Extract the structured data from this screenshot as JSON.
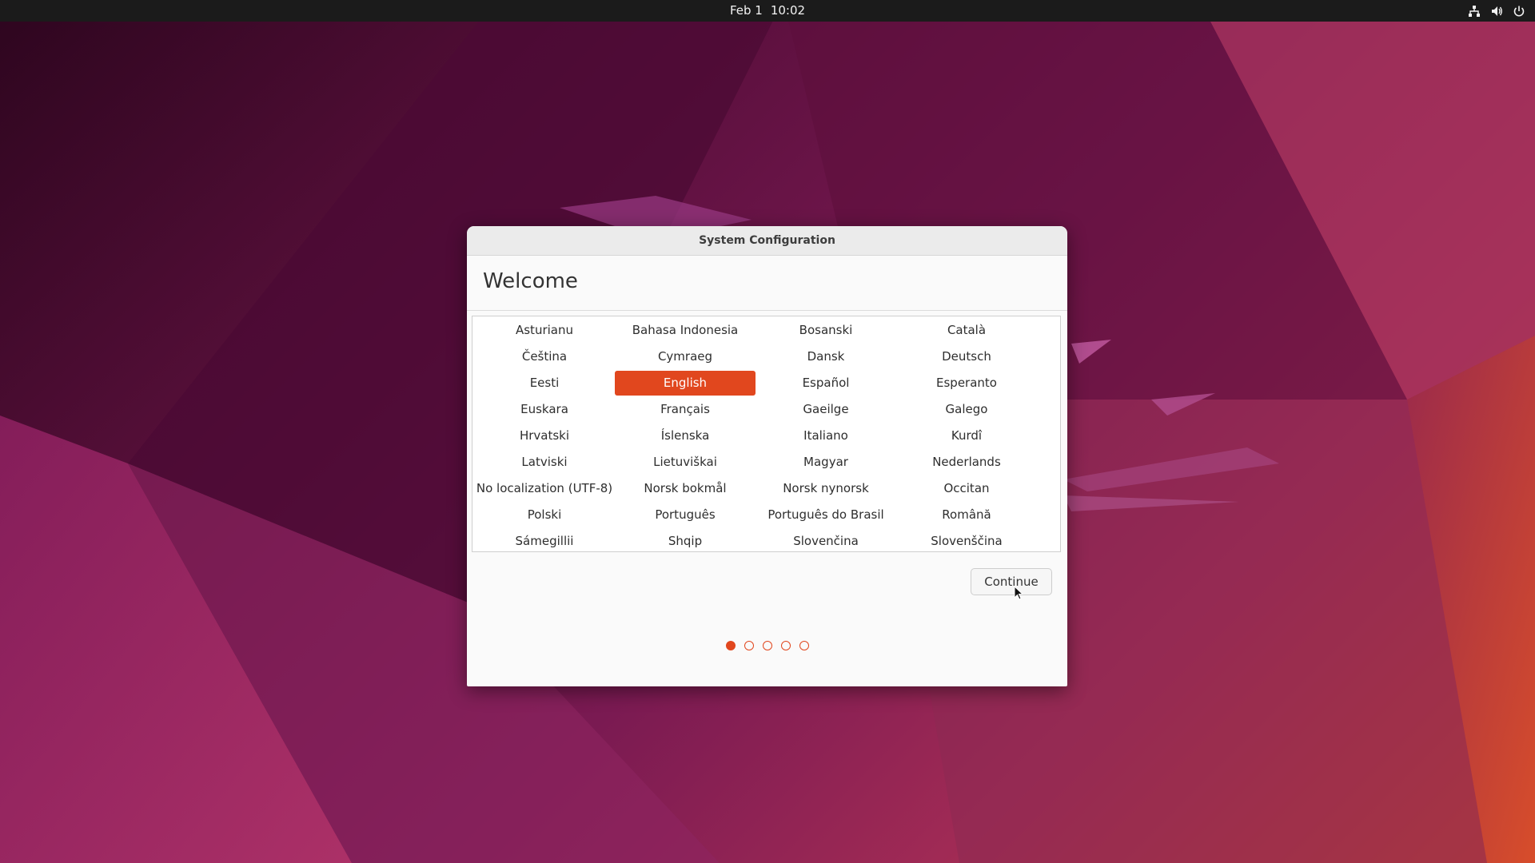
{
  "topbar": {
    "date": "Feb 1",
    "time": "10:02",
    "icons": [
      "network-icon",
      "volume-icon",
      "power-icon"
    ]
  },
  "dialog": {
    "title": "System Configuration",
    "heading": "Welcome",
    "languages": [
      "Asturianu",
      "Bahasa Indonesia",
      "Bosanski",
      "Català",
      "Čeština",
      "Cymraeg",
      "Dansk",
      "Deutsch",
      "Eesti",
      "English",
      "Español",
      "Esperanto",
      "Euskara",
      "Français",
      "Gaeilge",
      "Galego",
      "Hrvatski",
      "Íslenska",
      "Italiano",
      "Kurdî",
      "Latviski",
      "Lietuviškai",
      "Magyar",
      "Nederlands",
      "No localization (UTF-8)",
      "Norsk bokmål",
      "Norsk nynorsk",
      "Occitan",
      "Polski",
      "Português",
      "Português do Brasil",
      "Română",
      "Sámegillii",
      "Shqip",
      "Slovenčina",
      "Slovenščina"
    ],
    "selected_language": "English",
    "continue_label": "Continue",
    "pager": {
      "total": 5,
      "current": 1
    }
  },
  "colors": {
    "accent": "#e1471e",
    "topbar": "#1b1b1b",
    "dialog_bg": "#fafafa"
  }
}
